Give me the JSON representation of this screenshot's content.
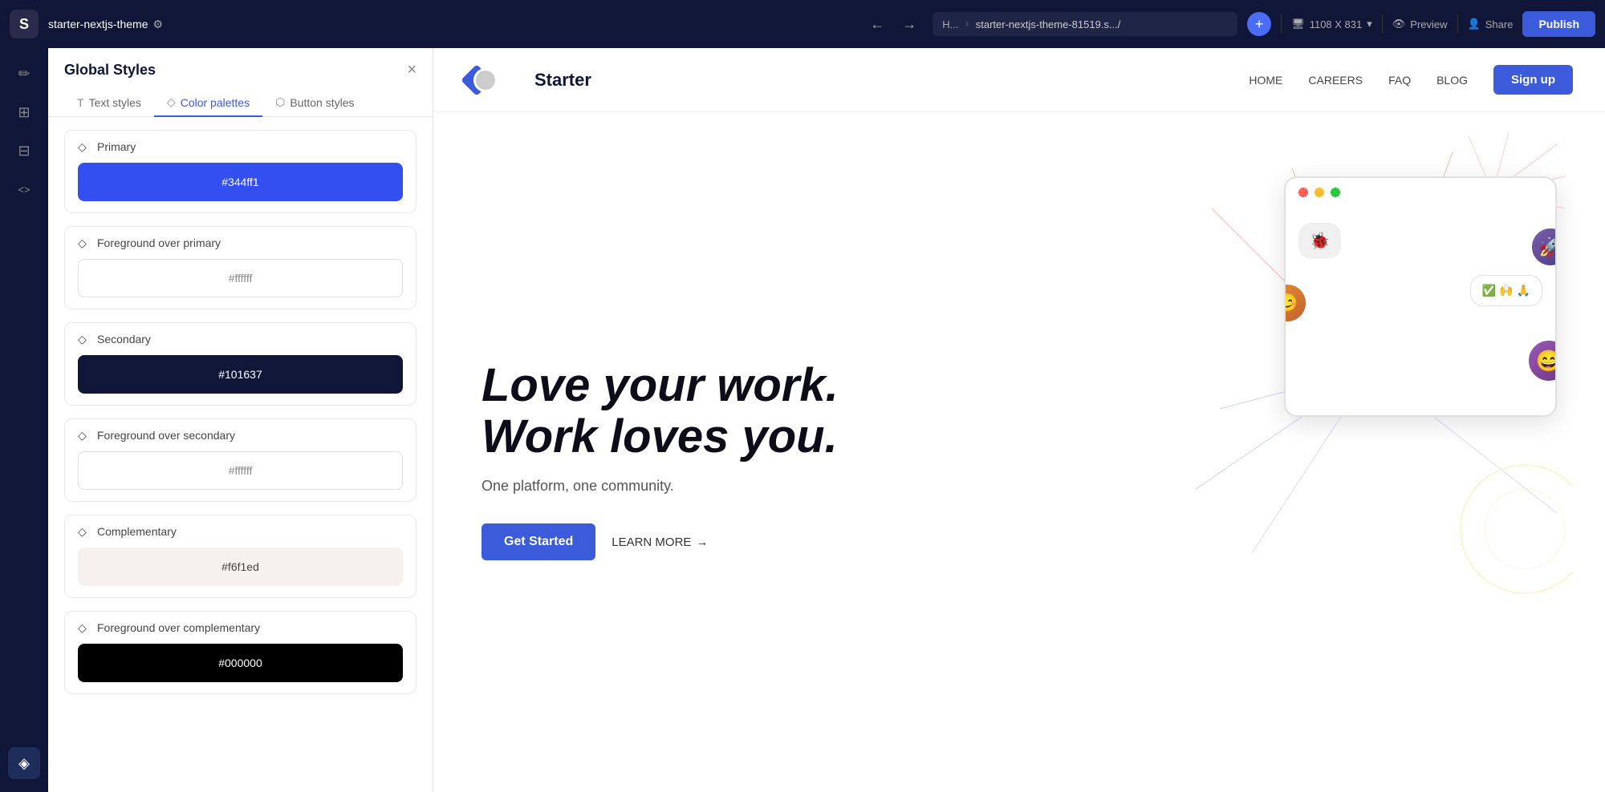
{
  "topbar": {
    "logo_text": "S",
    "project_name": "starter-nextjs-theme",
    "settings_icon": "⚙",
    "back_icon": "←",
    "forward_icon": "→",
    "url_label": "H...",
    "url_sep": "›",
    "url_text": "starter-nextjs-theme-81519.s.../",
    "device_label": "1108 X 831",
    "chevron_icon": "▾",
    "eye_icon": "👁",
    "preview_label": "Preview",
    "person_icon": "👤",
    "share_label": "Share",
    "publish_label": "Publish"
  },
  "panel": {
    "title": "Global Styles",
    "close_icon": "×",
    "tabs": [
      {
        "id": "text-styles",
        "label": "Text styles",
        "icon": "T"
      },
      {
        "id": "color-palettes",
        "label": "Color palettes",
        "icon": "◇"
      },
      {
        "id": "button-styles",
        "label": "Button styles",
        "icon": "⬡"
      }
    ],
    "active_tab": "color-palettes",
    "palettes": [
      {
        "id": "primary",
        "label": "Primary",
        "swatch_color": "#344ff1",
        "swatch_text": "#344ff1",
        "swatch_text_color": "#ffffff"
      },
      {
        "id": "foreground-primary",
        "label": "Foreground over primary",
        "swatch_color": "#ffffff",
        "swatch_text": "#ffffff",
        "swatch_text_color": "#888888",
        "has_border": true
      },
      {
        "id": "secondary",
        "label": "Secondary",
        "swatch_color": "#101637",
        "swatch_text": "#101637",
        "swatch_text_color": "#ffffff"
      },
      {
        "id": "foreground-secondary",
        "label": "Foreground over secondary",
        "swatch_color": "#ffffff",
        "swatch_text": "#ffffff",
        "swatch_text_color": "#888888",
        "has_border": true
      },
      {
        "id": "complementary",
        "label": "Complementary",
        "swatch_color": "#f6f1ed",
        "swatch_text": "#f6f1ed",
        "swatch_text_color": "#444444"
      },
      {
        "id": "foreground-complementary",
        "label": "Foreground over complementary",
        "swatch_color": "#000000",
        "swatch_text": "#000000",
        "swatch_text_color": "#ffffff"
      }
    ]
  },
  "website": {
    "nav": {
      "logo_text": "Starter",
      "links": [
        "HOME",
        "CAREERS",
        "FAQ",
        "BLOG"
      ],
      "signup_label": "Sign up"
    },
    "hero": {
      "heading_line1": "Love your work.",
      "heading_line2": "Work loves you.",
      "subtext": "One platform, one community.",
      "cta_primary": "Get Started",
      "cta_secondary": "LEARN MORE",
      "cta_arrow": "→"
    }
  },
  "rail_icons": {
    "edit_icon": "✏",
    "layout_icon": "⊞",
    "layers_icon": "⊟",
    "code_icon": "<>",
    "palette_icon": "◈"
  }
}
